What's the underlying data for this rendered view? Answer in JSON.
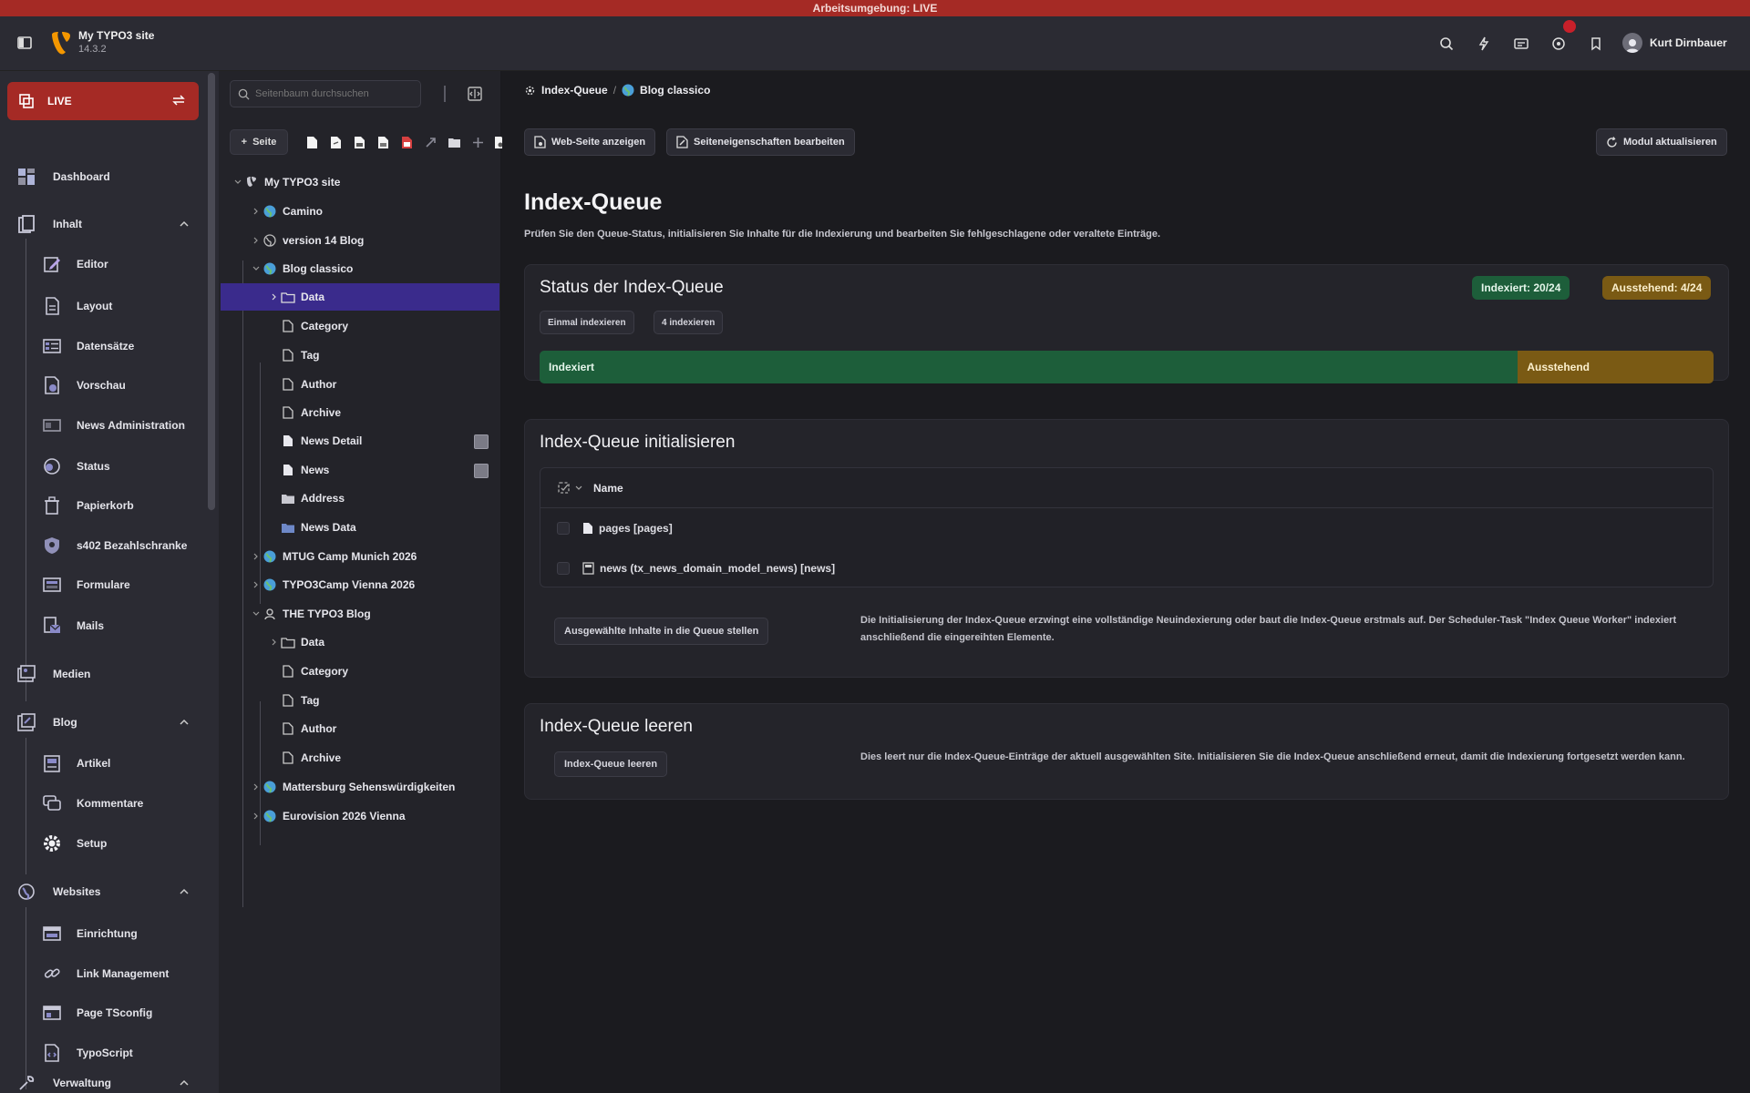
{
  "environment": {
    "label": "Arbeitsumgebung: LIVE"
  },
  "topbar": {
    "site_name": "My TYPO3 site",
    "version": "14.3.2",
    "notification_count": "",
    "user_name": "Kurt Dirnbauer"
  },
  "modmenu": {
    "live_label": "LIVE",
    "dashboard": "Dashboard",
    "inhalt": "Inhalt",
    "inhalt_items": [
      "Editor",
      "Layout",
      "Datensätze",
      "Vorschau",
      "News Administration",
      "Status",
      "Papierkorb",
      "s402 Bezahlschranke",
      "Formulare",
      "Mails"
    ],
    "medien": "Medien",
    "blog": "Blog",
    "blog_items": [
      "Artikel",
      "Kommentare",
      "Setup"
    ],
    "websites": "Websites",
    "websites_items": [
      "Einrichtung",
      "Link Management",
      "Page TSconfig",
      "TypoScript"
    ],
    "verwaltung": "Verwaltung"
  },
  "pagetree": {
    "search_placeholder": "Seitenbaum durchsuchen",
    "add_page": "Seite",
    "nodes": {
      "root": "My TYPO3 site",
      "camino": "Camino",
      "v14blog": "version 14 Blog",
      "blogclassico": "Blog classico",
      "data": "Data",
      "category": "Category",
      "tag": "Tag",
      "author": "Author",
      "archive": "Archive",
      "newsdetail": "News Detail",
      "news": "News",
      "address": "Address",
      "newsdata": "News Data",
      "mtug": "MTUG Camp Munich 2026",
      "typo3camp": "TYPO3Camp Vienna 2026",
      "thetypo3blog": "THE TYPO3 Blog",
      "data2": "Data",
      "category2": "Category",
      "tag2": "Tag",
      "author2": "Author",
      "archive2": "Archive",
      "mattersburg": "Mattersburg Sehenswürdigkeiten",
      "eurovision": "Eurovision 2026 Vienna"
    }
  },
  "main": {
    "breadcrumb": [
      "Index-Queue",
      "Blog classico"
    ],
    "btn_view": "Web-Seite anzeigen",
    "btn_edit": "Seiteneigenschaften bearbeiten",
    "btn_reload": "Modul aktualisieren",
    "title": "Index-Queue",
    "description": "Prüfen Sie den Queue-Status, initialisieren Sie Inhalte für die Indexierung und bearbeiten Sie fehlgeschlagene oder veraltete Einträge.",
    "status_card": {
      "title": "Status der Index-Queue",
      "badge_indexed": "Indexiert: 20/24",
      "badge_pending": "Ausstehend: 4/24",
      "btn_index_once": "Einmal indexieren",
      "btn_index_n": "4 indexieren",
      "seg_indexed_label": "Indexiert",
      "seg_pending_label": "Ausstehend",
      "indexed": 20,
      "pending": 4,
      "total": 24
    },
    "init_card": {
      "title": "Index-Queue initialisieren",
      "col_name": "Name",
      "rows": [
        "pages [pages]",
        "news (tx_news_domain_model_news) [news]"
      ],
      "btn_queue": "Ausgewählte Inhalte in die Queue stellen",
      "desc": "Die Initialisierung der Index-Queue erzwingt eine vollständige Neuindexierung oder baut die Index-Queue erstmals auf. Der Scheduler-Task \"Index Queue Worker\" indexiert anschließend die eingereihten Elemente."
    },
    "clear_card": {
      "title": "Index-Queue leeren",
      "btn_clear": "Index-Queue leeren",
      "desc": "Dies leert nur die Index-Queue-Einträge der aktuell ausgewählten Site. Initialisieren Sie die Index-Queue anschließend erneut, damit die Indexierung fortgesetzt werden kann."
    }
  },
  "colors": {
    "env": "#a52a25",
    "selected": "#3a2b8c",
    "indexed": "#1d5e3a",
    "pending": "#7a5a14",
    "globe": "#4a9fd8"
  }
}
